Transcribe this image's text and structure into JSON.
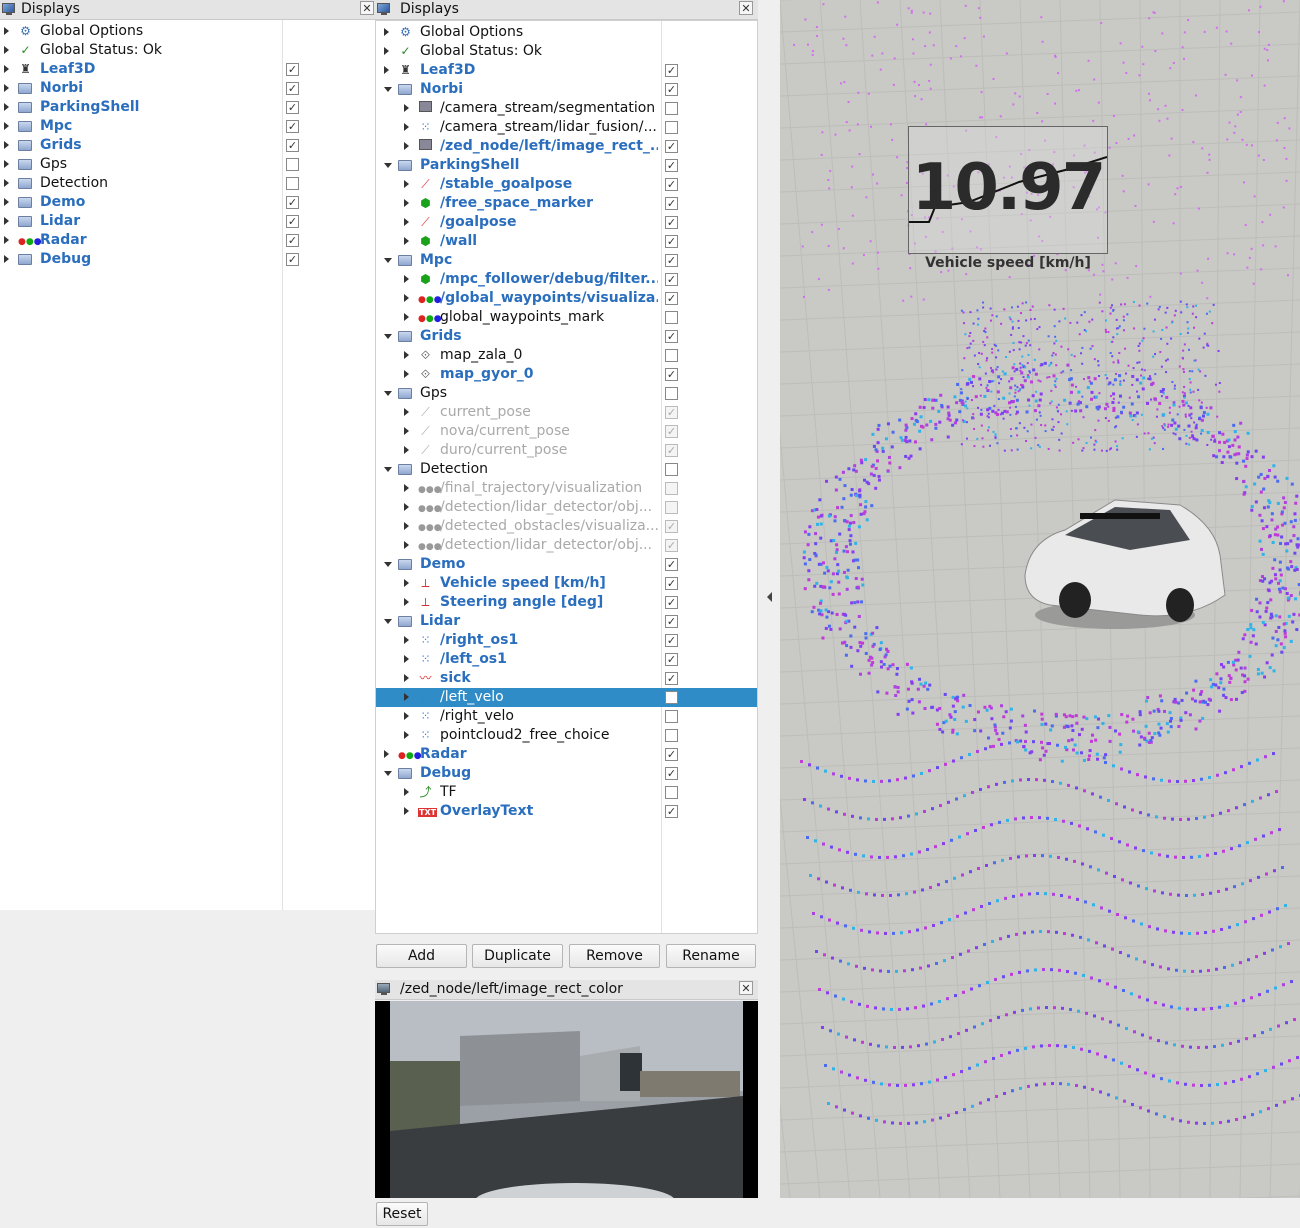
{
  "left_panel": {
    "title": "Displays",
    "items": [
      {
        "label": "Global Options",
        "style": "plain",
        "icon": "gear-icon",
        "arrow": "right",
        "check": null
      },
      {
        "label": "Global Status: Ok",
        "style": "plain",
        "icon": "checkmark-icon",
        "arrow": "right",
        "check": null
      },
      {
        "label": "Leaf3D",
        "style": "blue",
        "icon": "robot-model-icon",
        "arrow": "right",
        "check": true
      },
      {
        "label": "Norbi",
        "style": "blue",
        "icon": "folder-icon",
        "arrow": "right",
        "check": true
      },
      {
        "label": "ParkingShell",
        "style": "blue",
        "icon": "folder-icon",
        "arrow": "right",
        "check": true
      },
      {
        "label": "Mpc",
        "style": "blue",
        "icon": "folder-icon",
        "arrow": "right",
        "check": true
      },
      {
        "label": "Grids",
        "style": "blue",
        "icon": "folder-icon",
        "arrow": "right",
        "check": true
      },
      {
        "label": "Gps",
        "style": "plain",
        "icon": "folder-icon",
        "arrow": "right",
        "check": false
      },
      {
        "label": "Detection",
        "style": "plain",
        "icon": "folder-icon",
        "arrow": "right",
        "check": false
      },
      {
        "label": "Demo",
        "style": "blue",
        "icon": "folder-icon",
        "arrow": "right",
        "check": true
      },
      {
        "label": "Lidar",
        "style": "blue",
        "icon": "folder-icon",
        "arrow": "right",
        "check": true
      },
      {
        "label": "Radar",
        "style": "blue",
        "icon": "marker-array-icon",
        "arrow": "right",
        "check": true
      },
      {
        "label": "Debug",
        "style": "blue",
        "icon": "folder-icon",
        "arrow": "right",
        "check": true
      }
    ]
  },
  "right_panel": {
    "title": "Displays",
    "items": [
      {
        "label": "Global Options",
        "style": "plain",
        "icon": "gear-icon",
        "arrow": "right",
        "indent": 0,
        "check": null
      },
      {
        "label": "Global Status: Ok",
        "style": "plain",
        "icon": "checkmark-icon",
        "arrow": "right",
        "indent": 0,
        "check": null
      },
      {
        "label": "Leaf3D",
        "style": "blue",
        "icon": "robot-model-icon",
        "arrow": "right",
        "indent": 0,
        "check": true
      },
      {
        "label": "Norbi",
        "style": "blue",
        "icon": "folder-icon",
        "arrow": "down",
        "indent": 0,
        "check": true
      },
      {
        "label": "/camera_stream/segmentation",
        "style": "plain",
        "icon": "image-icon",
        "arrow": "right",
        "indent": 1,
        "check": false
      },
      {
        "label": "/camera_stream/lidar_fusion/...",
        "style": "plain",
        "icon": "pointcloud-icon",
        "arrow": "right",
        "indent": 1,
        "check": false
      },
      {
        "label": "/zed_node/left/image_rect_...",
        "style": "blue",
        "icon": "image-icon",
        "arrow": "right",
        "indent": 1,
        "check": true
      },
      {
        "label": "ParkingShell",
        "style": "blue",
        "icon": "folder-icon",
        "arrow": "down",
        "indent": 0,
        "check": true
      },
      {
        "label": "/stable_goalpose",
        "style": "blue",
        "icon": "pose-icon",
        "arrow": "right",
        "indent": 1,
        "check": true
      },
      {
        "label": "/free_space_marker",
        "style": "blue",
        "icon": "marker-icon",
        "arrow": "right",
        "indent": 1,
        "check": true
      },
      {
        "label": "/goalpose",
        "style": "blue",
        "icon": "pose-icon",
        "arrow": "right",
        "indent": 1,
        "check": true
      },
      {
        "label": "/wall",
        "style": "blue",
        "icon": "marker-icon",
        "arrow": "right",
        "indent": 1,
        "check": true
      },
      {
        "label": "Mpc",
        "style": "blue",
        "icon": "folder-icon",
        "arrow": "down",
        "indent": 0,
        "check": true
      },
      {
        "label": "/mpc_follower/debug/filter...",
        "style": "blue",
        "icon": "marker-icon",
        "arrow": "right",
        "indent": 1,
        "check": true
      },
      {
        "label": "/global_waypoints/visualiza...",
        "style": "blue",
        "icon": "marker-array-icon",
        "arrow": "right",
        "indent": 1,
        "check": true
      },
      {
        "label": "global_waypoints_mark",
        "style": "plain",
        "icon": "marker-array-icon",
        "arrow": "right",
        "indent": 1,
        "check": false
      },
      {
        "label": "Grids",
        "style": "blue",
        "icon": "folder-icon",
        "arrow": "down",
        "indent": 0,
        "check": true
      },
      {
        "label": "map_zala_0",
        "style": "plain",
        "icon": "grid-icon",
        "arrow": "right",
        "indent": 1,
        "check": false
      },
      {
        "label": "map_gyor_0",
        "style": "blue",
        "icon": "grid-icon",
        "arrow": "right",
        "indent": 1,
        "check": true
      },
      {
        "label": "Gps",
        "style": "plain",
        "icon": "folder-icon",
        "arrow": "down",
        "indent": 0,
        "check": false
      },
      {
        "label": "current_pose",
        "style": "gray",
        "icon": "pose-gray-icon",
        "arrow": "right",
        "indent": 1,
        "check": "dis"
      },
      {
        "label": "nova/current_pose",
        "style": "gray",
        "icon": "pose-gray-icon",
        "arrow": "right",
        "indent": 1,
        "check": "dis"
      },
      {
        "label": "duro/current_pose",
        "style": "gray",
        "icon": "pose-gray-icon",
        "arrow": "right",
        "indent": 1,
        "check": "dis"
      },
      {
        "label": "Detection",
        "style": "plain",
        "icon": "folder-icon",
        "arrow": "down",
        "indent": 0,
        "check": false
      },
      {
        "label": "/final_trajectory/visualization",
        "style": "gray",
        "icon": "marker-array-gray-icon",
        "arrow": "right",
        "indent": 1,
        "check": "dis-empty"
      },
      {
        "label": "/detection/lidar_detector/obj...",
        "style": "gray",
        "icon": "marker-array-gray-icon",
        "arrow": "right",
        "indent": 1,
        "check": "dis-empty"
      },
      {
        "label": "/detected_obstacles/visualiza...",
        "style": "gray",
        "icon": "marker-array-gray-icon",
        "arrow": "right",
        "indent": 1,
        "check": "dis"
      },
      {
        "label": "/detection/lidar_detector/obj...",
        "style": "gray",
        "icon": "marker-array-gray-icon",
        "arrow": "right",
        "indent": 1,
        "check": "dis"
      },
      {
        "label": "Demo",
        "style": "blue",
        "icon": "folder-icon",
        "arrow": "down",
        "indent": 0,
        "check": true
      },
      {
        "label": "Vehicle speed [km/h]",
        "style": "blue",
        "icon": "plot-icon",
        "arrow": "right",
        "indent": 1,
        "check": true
      },
      {
        "label": "Steering angle [deg]",
        "style": "blue",
        "icon": "plot-icon",
        "arrow": "right",
        "indent": 1,
        "check": true
      },
      {
        "label": "Lidar",
        "style": "blue",
        "icon": "folder-icon",
        "arrow": "down",
        "indent": 0,
        "check": true
      },
      {
        "label": "/right_os1",
        "style": "blue",
        "icon": "pointcloud-icon",
        "arrow": "right",
        "indent": 1,
        "check": true
      },
      {
        "label": "/left_os1",
        "style": "blue",
        "icon": "pointcloud-icon",
        "arrow": "right",
        "indent": 1,
        "check": true
      },
      {
        "label": "sick",
        "style": "blue",
        "icon": "laserscan-icon",
        "arrow": "right",
        "indent": 1,
        "check": true
      },
      {
        "label": "/left_velo",
        "style": "plain",
        "icon": "pointcloud-icon",
        "arrow": "right",
        "indent": 1,
        "check": false,
        "selected": true
      },
      {
        "label": "/right_velo",
        "style": "plain",
        "icon": "pointcloud-icon",
        "arrow": "right",
        "indent": 1,
        "check": false
      },
      {
        "label": "pointcloud2_free_choice",
        "style": "plain",
        "icon": "pointcloud-icon",
        "arrow": "right",
        "indent": 1,
        "check": false
      },
      {
        "label": "Radar",
        "style": "blue",
        "icon": "marker-array-icon",
        "arrow": "right",
        "indent": 0,
        "check": true
      },
      {
        "label": "Debug",
        "style": "blue",
        "icon": "folder-icon",
        "arrow": "down",
        "indent": 0,
        "check": true
      },
      {
        "label": "TF",
        "style": "plain",
        "icon": "tf-icon",
        "arrow": "right",
        "indent": 1,
        "check": false
      },
      {
        "label": "OverlayText",
        "style": "blue",
        "icon": "overlay-text-icon",
        "arrow": "right",
        "indent": 1,
        "check": true
      }
    ],
    "buttons": {
      "add": "Add",
      "duplicate": "Duplicate",
      "remove": "Remove",
      "rename": "Rename"
    }
  },
  "image_panel": {
    "title": "/zed_node/left/image_rect_color"
  },
  "overlay": {
    "value": "10.97",
    "caption": "Vehicle speed [km/h]"
  },
  "bottom": {
    "reset": "Reset"
  },
  "colors": {
    "blue_label": "#2a6ebd",
    "selection": "#308cc6",
    "viewport_floor": "#c9c9c6"
  }
}
